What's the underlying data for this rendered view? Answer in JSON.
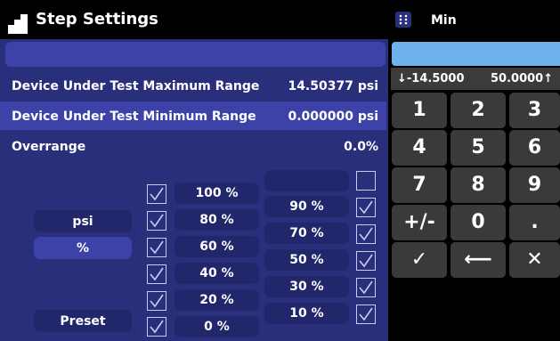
{
  "header": {
    "title": "Step Settings"
  },
  "rows": {
    "max": {
      "label": "Device Under Test Maximum Range",
      "value": "14.50377 psi"
    },
    "min": {
      "label": "Device Under Test Minimum Range",
      "value": "0.000000 psi"
    },
    "overrange": {
      "label": "Overrange",
      "value": "0.0%"
    }
  },
  "units": {
    "psi": "psi",
    "percent": "%"
  },
  "preset_label": "Preset",
  "steps_left": [
    "100 %",
    "80 %",
    "60 %",
    "40 %",
    "20 %",
    "0 %"
  ],
  "steps_right": [
    "",
    "90 %",
    "70 %",
    "50 %",
    "30 %",
    "10 %"
  ],
  "keypad": {
    "field_name": "Min",
    "entry_value": "",
    "min_limit": "↓-14.5000",
    "max_limit": "50.0000↑",
    "keys": [
      "1",
      "2",
      "3",
      "4",
      "5",
      "6",
      "7",
      "8",
      "9",
      "+/-",
      "0",
      ".",
      "✓",
      "⟵",
      "✕"
    ]
  }
}
